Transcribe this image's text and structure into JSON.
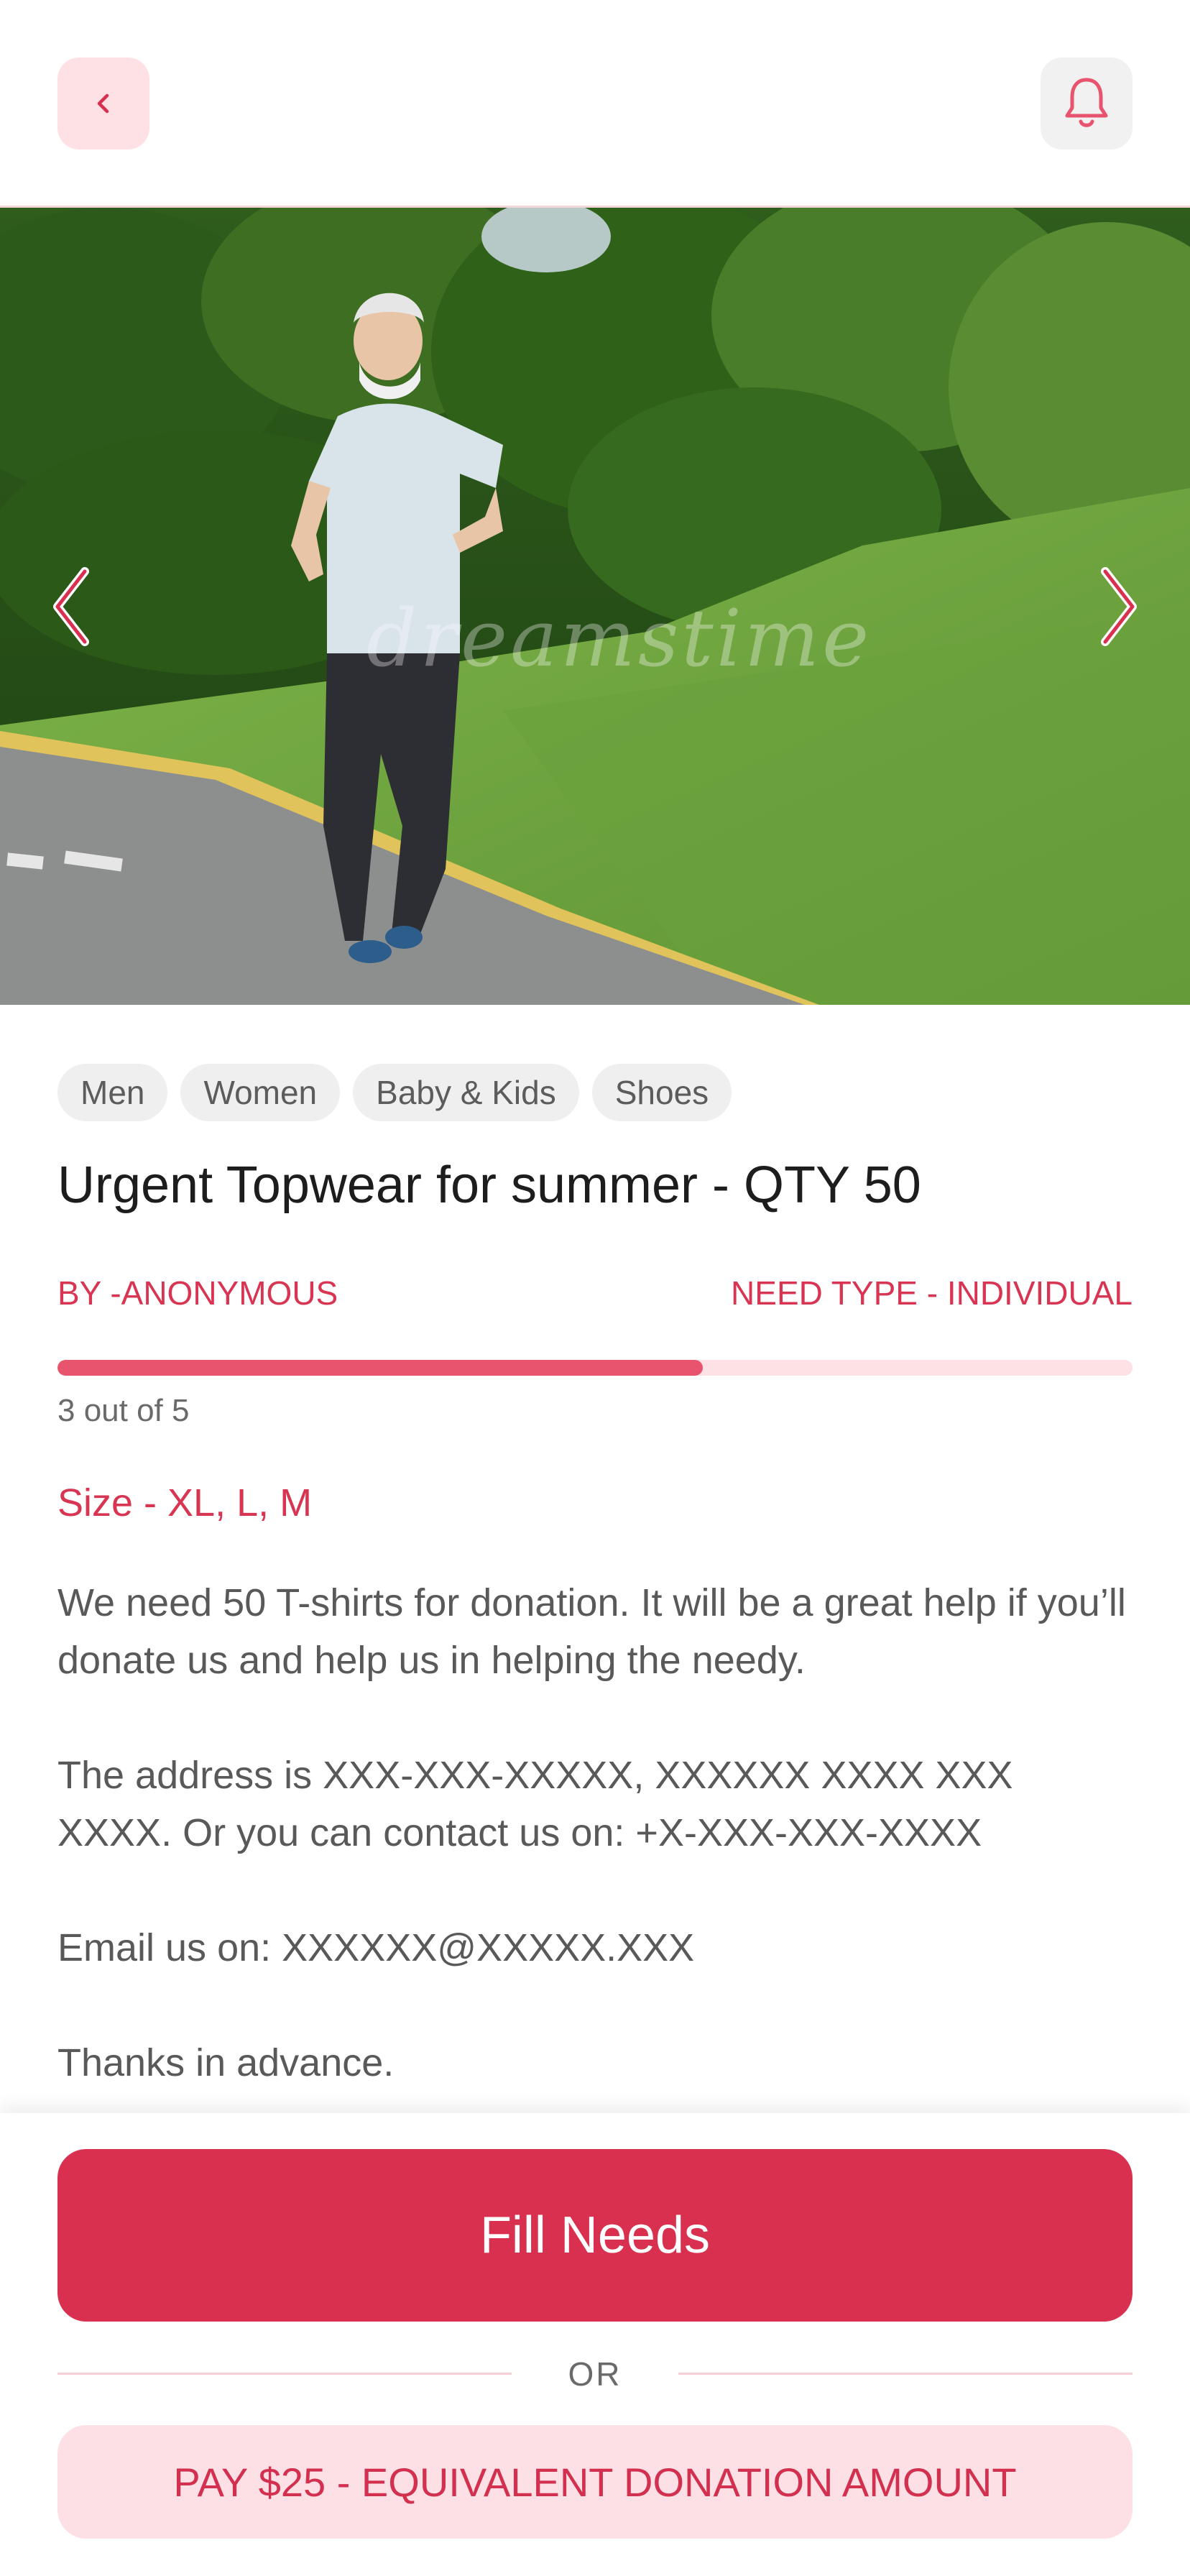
{
  "header": {
    "back_icon": "chevron-left-icon",
    "notification_icon": "bell-icon"
  },
  "hero": {
    "watermark": "dreamstime",
    "prev_icon": "chevron-left-icon",
    "next_icon": "chevron-right-icon"
  },
  "tags": [
    "Men",
    "Women",
    "Baby & Kids",
    "Shoes"
  ],
  "post": {
    "title": "Urgent Topwear for summer - QTY 50",
    "by": "BY  -ANONYMOUS",
    "need_type": "NEED TYPE - INDIVIDUAL",
    "progress_text": "3 out of 5",
    "progress_fraction": 0.6,
    "size": "Size - XL, L, M",
    "description": [
      "We need 50 T-shirts for donation. It will be a great help if you’ll donate us and help us in helping the needy.",
      "The address is XXX-XXX-XXXXX, XXXXXX XXXX XXX XXXX. Or you can contact us on: +X-XXX-XXX-XXXX",
      "Email us on: XXXXXX@XXXXX.XXX",
      "Thanks in advance."
    ]
  },
  "actions": {
    "fill_label": "Fill Needs",
    "or_label": "OR",
    "pay_label": "PAY $25 - EQUIVALENT DONATION AMOUNT"
  },
  "colors": {
    "accent": "#d9304f",
    "accent_light": "#fde0e5",
    "progress_fill": "#e8546d"
  }
}
